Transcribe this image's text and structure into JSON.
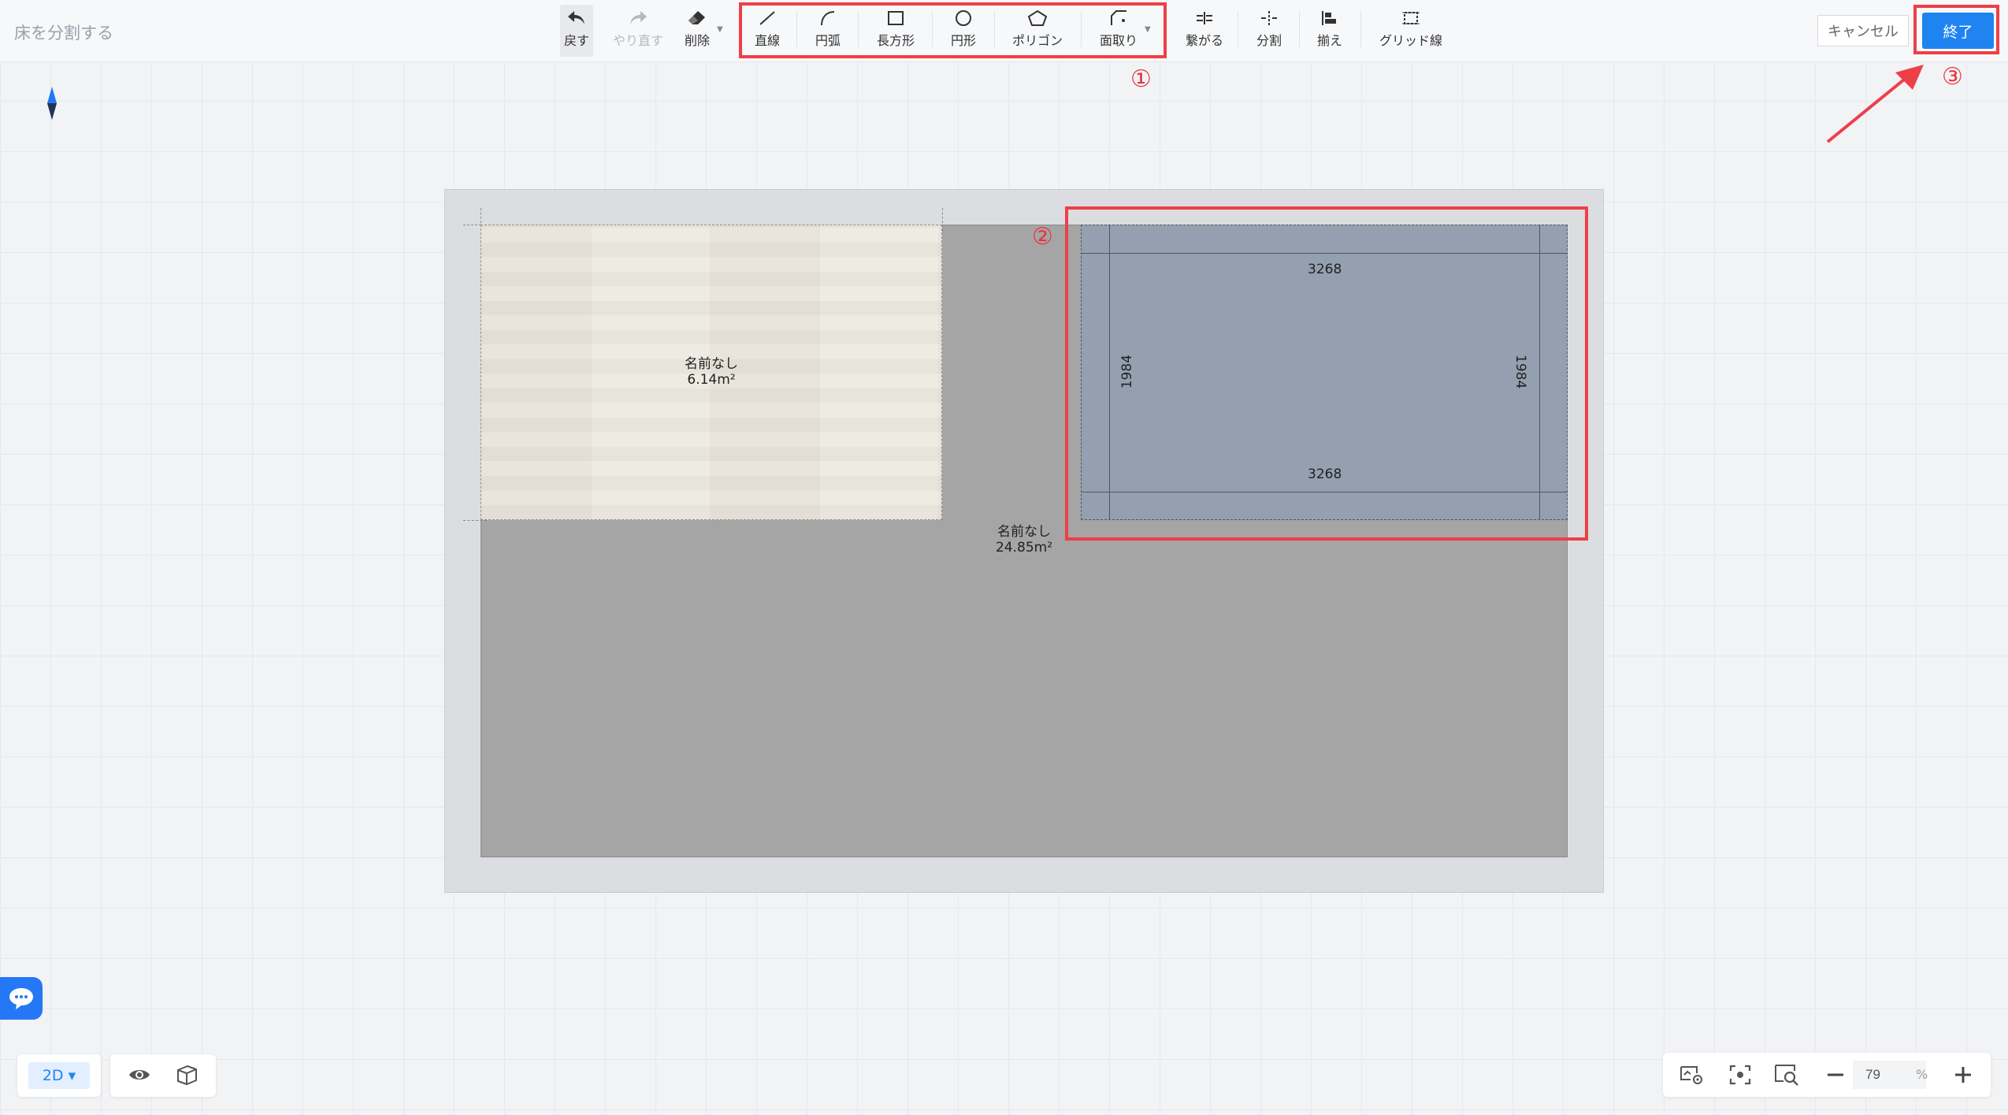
{
  "header": {
    "title": "床を分割する"
  },
  "toolbar": {
    "undo": "戻す",
    "redo": "やり直す",
    "delete": "削除",
    "line": "直線",
    "arc": "円弧",
    "rectangle": "長方形",
    "circle": "円形",
    "polygon": "ポリゴン",
    "chamfer": "面取り",
    "connect": "繋がる",
    "split": "分割",
    "align": "揃え",
    "gridline": "グリッド線"
  },
  "actions": {
    "cancel": "キャンセル",
    "finish": "終了"
  },
  "annotations": {
    "step1": "①",
    "step2": "②",
    "step3": "③",
    "color": "#ee3f48"
  },
  "rooms": [
    {
      "name": "名前なし",
      "area": "6.14m²"
    },
    {
      "name": "名前なし",
      "area": "24.85m²"
    }
  ],
  "dimensions": {
    "top": "3268",
    "bottom": "3268",
    "left": "1984",
    "right": "1984"
  },
  "bottombar": {
    "view_mode": "2D ▾",
    "zoom_value": "79",
    "zoom_unit": "%"
  },
  "colors": {
    "accent": "#1f84f2",
    "floor": "#a5a5a5",
    "selected_room": "#94a0b0"
  }
}
